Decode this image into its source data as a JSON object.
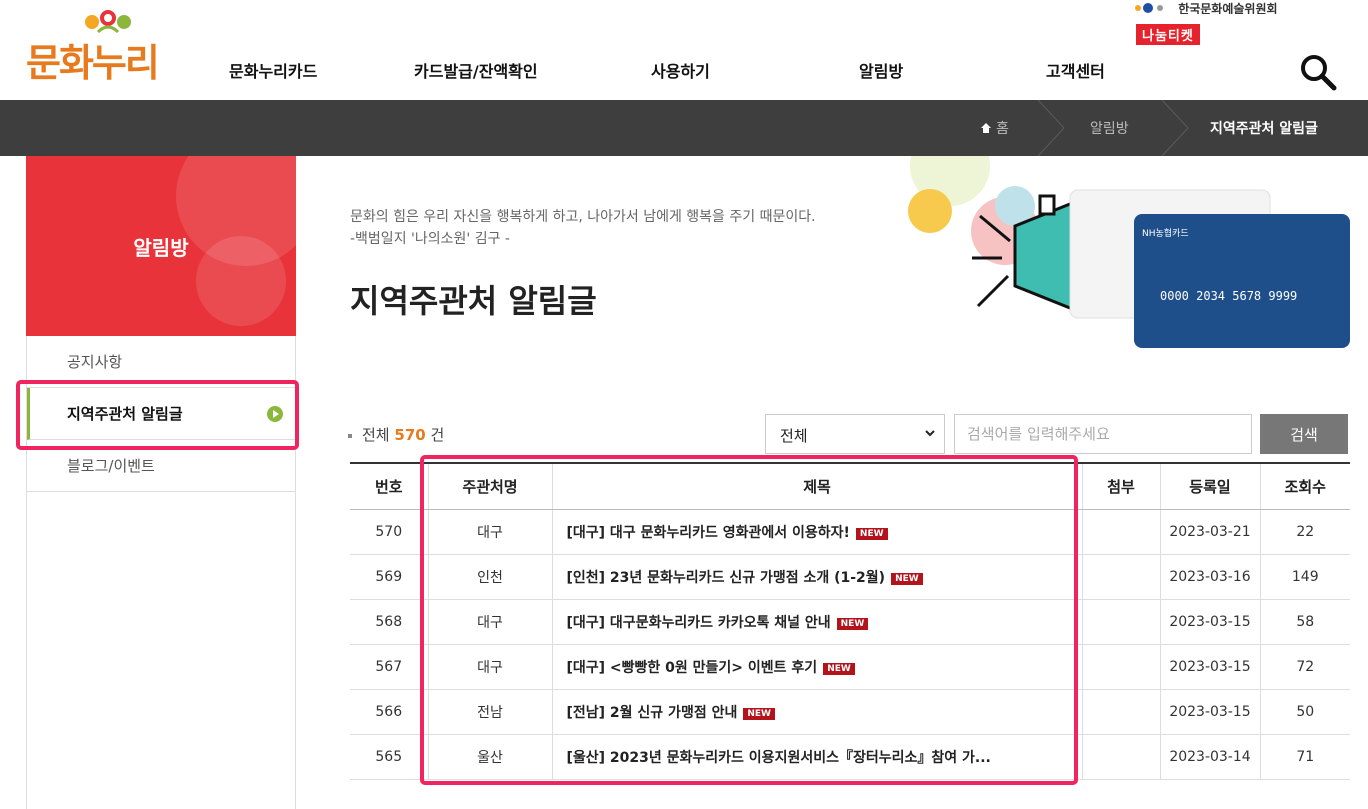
{
  "header": {
    "logo_text": "문화누리",
    "nav": [
      "문화누리카드",
      "카드발급/잔액확인",
      "사용하기",
      "알림방",
      "고객센터"
    ],
    "partner_text": "한국문화예술위원회",
    "partner_badge": "나눔티켓"
  },
  "breadcrumb": {
    "home": "홈",
    "section": "알림방",
    "current": "지역주관처 알림글"
  },
  "sidebar": {
    "title": "알림방",
    "items": [
      {
        "label": "공지사항"
      },
      {
        "label": "지역주관처 알림글"
      },
      {
        "label": "블로그/이벤트"
      }
    ]
  },
  "main": {
    "quote_line1": "문화의 힘은 우리 자신을 행복하게 하고, 나아가서 남에게 행복을 주기 때문이다.",
    "quote_line2": "-백범일지 '나의소원' 김구 -",
    "title": "지역주관처 알림글",
    "card_brand": "NH농협카드",
    "card_number": "0000 2034 5678 9999"
  },
  "list": {
    "total_label": "전체",
    "total_count": "570",
    "total_unit": "건",
    "select_value": "전체",
    "search_placeholder": "검색어를 입력해주세요",
    "search_button": "검색",
    "columns": [
      "번호",
      "주관처명",
      "제목",
      "첨부",
      "등록일",
      "조회수"
    ],
    "new_badge": "NEW",
    "rows": [
      {
        "no": "570",
        "org": "대구",
        "title": "[대구] 대구 문화누리카드 영화관에서 이용하자!",
        "attach": "",
        "date": "2023-03-21",
        "views": "22",
        "new": true
      },
      {
        "no": "569",
        "org": "인천",
        "title": "[인천] 23년 문화누리카드 신규 가맹점 소개 (1-2월)",
        "attach": "",
        "date": "2023-03-16",
        "views": "149",
        "new": true
      },
      {
        "no": "568",
        "org": "대구",
        "title": "[대구] 대구문화누리카드 카카오톡 채널 안내",
        "attach": "",
        "date": "2023-03-15",
        "views": "58",
        "new": true
      },
      {
        "no": "567",
        "org": "대구",
        "title": "[대구] <빵빵한 0원 만들기> 이벤트 후기",
        "attach": "",
        "date": "2023-03-15",
        "views": "72",
        "new": true
      },
      {
        "no": "566",
        "org": "전남",
        "title": "[전남] 2월 신규 가맹점 안내",
        "attach": "",
        "date": "2023-03-15",
        "views": "50",
        "new": true
      },
      {
        "no": "565",
        "org": "울산",
        "title": "[울산] 2023년 문화누리카드 이용지원서비스『장터누리소』참여 가...",
        "attach": "",
        "date": "2023-03-14",
        "views": "71",
        "new": false
      }
    ]
  },
  "colors": {
    "accent_red": "#e8333a",
    "highlight": "#f0245e",
    "active_green": "#8cb63c",
    "count_orange": "#e87a1e"
  }
}
